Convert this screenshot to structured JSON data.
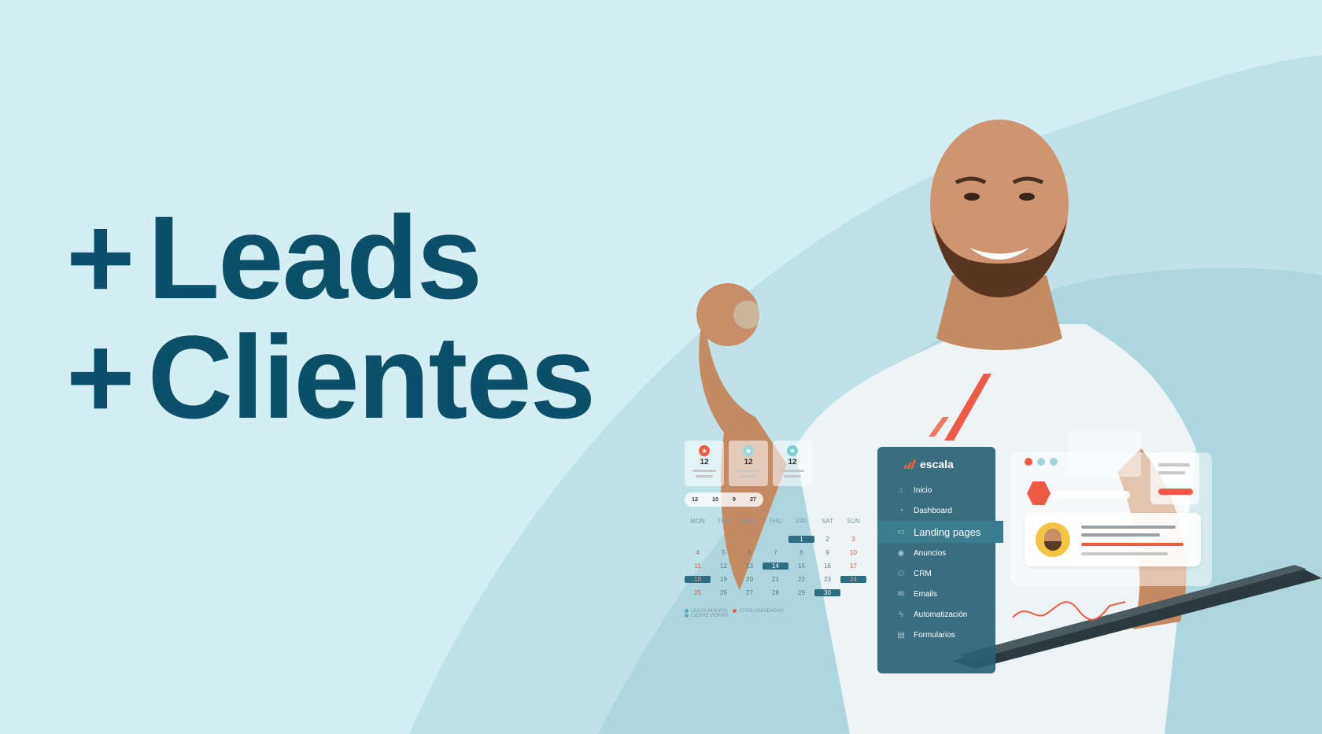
{
  "headline": {
    "plus": "+",
    "line1": "Leads",
    "line2": "Clientes"
  },
  "calendar": {
    "cards": [
      {
        "value": "12",
        "badge_color": "#ef5a44"
      },
      {
        "value": "12",
        "badge_color": "#9fd6dc"
      },
      {
        "value": "12",
        "badge_color": "#7dd0cf"
      }
    ],
    "pill": [
      "12",
      "10",
      "9",
      "27"
    ],
    "weekdays": [
      "MON",
      "TUE",
      "WED",
      "THU",
      "FRI",
      "SAT",
      "SUN"
    ],
    "days": [
      {
        "d": "",
        "s": ""
      },
      {
        "d": "",
        "s": ""
      },
      {
        "d": "",
        "s": ""
      },
      {
        "d": "",
        "s": ""
      },
      {
        "d": "1",
        "s": "hl"
      },
      {
        "d": "2",
        "s": ""
      },
      {
        "d": "3",
        "s": "red"
      },
      {
        "d": "4",
        "s": "red"
      },
      {
        "d": "5",
        "s": ""
      },
      {
        "d": "6",
        "s": ""
      },
      {
        "d": "7",
        "s": ""
      },
      {
        "d": "8",
        "s": ""
      },
      {
        "d": "9",
        "s": ""
      },
      {
        "d": "10",
        "s": "red"
      },
      {
        "d": "11",
        "s": "red"
      },
      {
        "d": "12",
        "s": ""
      },
      {
        "d": "13",
        "s": ""
      },
      {
        "d": "14",
        "s": "hl"
      },
      {
        "d": "15",
        "s": ""
      },
      {
        "d": "16",
        "s": ""
      },
      {
        "d": "17",
        "s": "red"
      },
      {
        "d": "18",
        "s": "hlr"
      },
      {
        "d": "19",
        "s": ""
      },
      {
        "d": "20",
        "s": ""
      },
      {
        "d": "21",
        "s": ""
      },
      {
        "d": "22",
        "s": ""
      },
      {
        "d": "23",
        "s": ""
      },
      {
        "d": "24",
        "s": "hlr"
      },
      {
        "d": "25",
        "s": "red"
      },
      {
        "d": "26",
        "s": ""
      },
      {
        "d": "27",
        "s": ""
      },
      {
        "d": "28",
        "s": ""
      },
      {
        "d": "29",
        "s": ""
      },
      {
        "d": "30",
        "s": "hl"
      },
      {
        "d": "",
        "s": ""
      }
    ],
    "legend": [
      "LEADS NUEVOS",
      "CITAS AGENDADAS",
      "CIERRE VENTAS"
    ]
  },
  "sidebar": {
    "brand": "escala",
    "items": [
      {
        "label": "Inicio",
        "icon": "home-icon",
        "glyph": "⌂"
      },
      {
        "label": "Dashboard",
        "icon": "pie-chart-icon",
        "glyph": "◔"
      },
      {
        "label": "Landing pages",
        "icon": "page-icon",
        "glyph": "▭"
      },
      {
        "label": "Anuncios",
        "icon": "target-icon",
        "glyph": "◉"
      },
      {
        "label": "CRM",
        "icon": "users-icon",
        "glyph": "⚇"
      },
      {
        "label": "Emails",
        "icon": "mail-icon",
        "glyph": "✉"
      },
      {
        "label": "Automatización",
        "icon": "bolt-icon",
        "glyph": "ϟ"
      },
      {
        "label": "Formularios",
        "icon": "form-icon",
        "glyph": "▤"
      }
    ]
  },
  "colors": {
    "background": "#d3eff3",
    "headline": "#0b5068",
    "accent": "#ef5a44",
    "panel": "#286273"
  }
}
